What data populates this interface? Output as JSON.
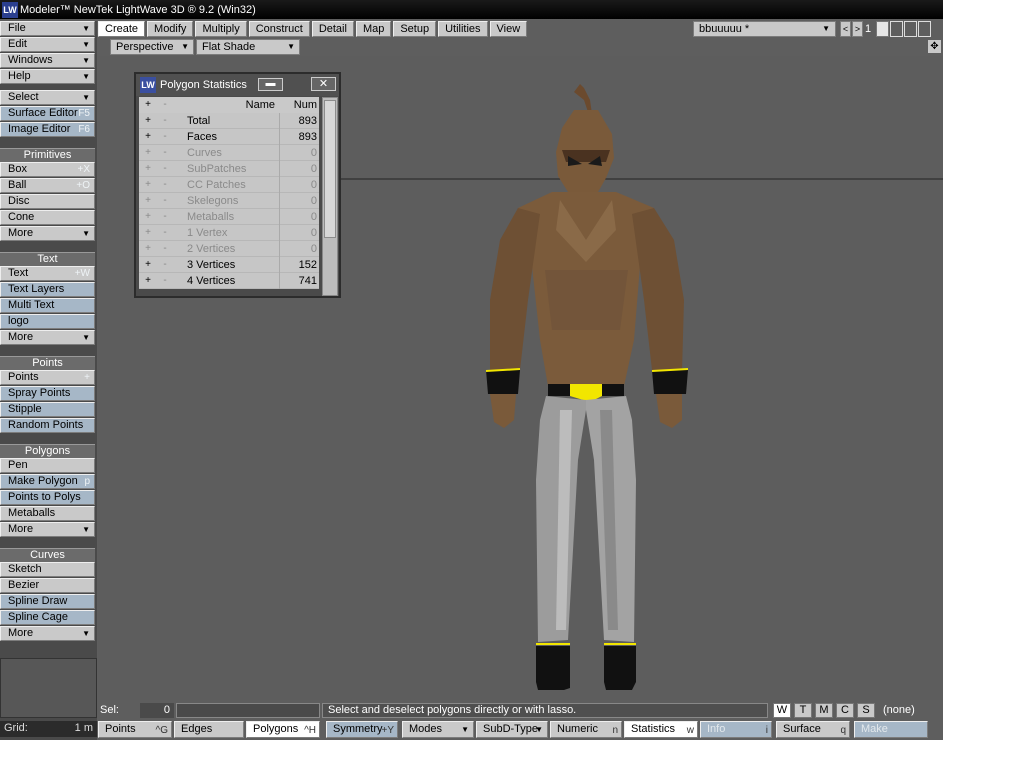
{
  "window": {
    "title": "Modeler™ NewTek LightWave 3D ® 9.2 (Win32)",
    "icon": "lightwave-logo-icon"
  },
  "sidebar": {
    "menus": [
      {
        "label": "File"
      },
      {
        "label": "Edit"
      },
      {
        "label": "Windows"
      },
      {
        "label": "Help"
      }
    ],
    "select_label": "Select",
    "surface_editor": {
      "label": "Surface Editor",
      "shortcut": "F5"
    },
    "image_editor": {
      "label": "Image Editor",
      "shortcut": "F6"
    },
    "primitives": {
      "header": "Primitives",
      "items": [
        {
          "label": "Box",
          "shortcut": "+X"
        },
        {
          "label": "Ball",
          "shortcut": "+O"
        },
        {
          "label": "Disc",
          "shortcut": ""
        },
        {
          "label": "Cone",
          "shortcut": ""
        },
        {
          "label": "More",
          "shortcut": ""
        }
      ]
    },
    "text": {
      "header": "Text",
      "items": [
        {
          "label": "Text",
          "shortcut": "+W"
        },
        {
          "label": "Text Layers",
          "shortcut": ""
        },
        {
          "label": "Multi Text",
          "shortcut": ""
        },
        {
          "label": "logo",
          "shortcut": ""
        },
        {
          "label": "More",
          "shortcut": ""
        }
      ]
    },
    "points": {
      "header": "Points",
      "items": [
        {
          "label": "Points",
          "shortcut": "+"
        },
        {
          "label": "Spray Points",
          "shortcut": ""
        },
        {
          "label": "Stipple",
          "shortcut": ""
        },
        {
          "label": "Random Points",
          "shortcut": ""
        }
      ]
    },
    "polygons": {
      "header": "Polygons",
      "items": [
        {
          "label": "Pen",
          "shortcut": ""
        },
        {
          "label": "Make Polygon",
          "shortcut": "p"
        },
        {
          "label": "Points to Polys",
          "shortcut": ""
        },
        {
          "label": "Metaballs",
          "shortcut": ""
        },
        {
          "label": "More",
          "shortcut": ""
        }
      ]
    },
    "curves": {
      "header": "Curves",
      "items": [
        {
          "label": "Sketch",
          "shortcut": ""
        },
        {
          "label": "Bezier",
          "shortcut": ""
        },
        {
          "label": "Spline Draw",
          "shortcut": ""
        },
        {
          "label": "Spline Cage",
          "shortcut": ""
        },
        {
          "label": "More",
          "shortcut": ""
        }
      ]
    },
    "grid": {
      "label": "Grid:",
      "value": "1 m"
    }
  },
  "tabs": [
    "Create",
    "Modify",
    "Multiply",
    "Construct",
    "Detail",
    "Map",
    "Setup",
    "Utilities",
    "View"
  ],
  "active_tab": "Create",
  "layer": {
    "name": "bbuuuuu *",
    "prev": "<",
    "next": ">",
    "number": "1"
  },
  "viewport": {
    "view": "Perspective",
    "shading": "Flat Shade",
    "move_glyph": "✥"
  },
  "stats_panel": {
    "title": "Polygon Statistics",
    "minimize": "▬",
    "close": "✕",
    "header": {
      "plus": "+",
      "minus": "-",
      "name": "Name",
      "num": "Num"
    },
    "rows": [
      {
        "name": "Total",
        "num": "893",
        "active": true
      },
      {
        "name": "Faces",
        "num": "893",
        "active": true
      },
      {
        "name": "Curves",
        "num": "0",
        "active": false
      },
      {
        "name": "SubPatches",
        "num": "0",
        "active": false
      },
      {
        "name": "CC Patches",
        "num": "0",
        "active": false
      },
      {
        "name": "Skelegons",
        "num": "0",
        "active": false
      },
      {
        "name": "Metaballs",
        "num": "0",
        "active": false
      },
      {
        "name": "1 Vertex",
        "num": "0",
        "active": false
      },
      {
        "name": "2 Vertices",
        "num": "0",
        "active": false
      },
      {
        "name": "3 Vertices",
        "num": "152",
        "active": true
      },
      {
        "name": "4 Vertices",
        "num": "741",
        "active": true
      }
    ]
  },
  "status": {
    "sel_label": "Sel:",
    "sel_value": "0",
    "hint": "Select and deselect polygons directly or with lasso.",
    "wtmcs": [
      "W",
      "T",
      "M",
      "C",
      "S"
    ],
    "surface_none": "(none)"
  },
  "bottom_toolbar": {
    "points": {
      "label": "Points",
      "shortcut": "^G"
    },
    "edges": {
      "label": "Edges",
      "shortcut": ""
    },
    "polygons": {
      "label": "Polygons",
      "shortcut": "^H"
    },
    "symmetry": {
      "label": "Symmetry",
      "shortcut": "+Y"
    },
    "modes": "Modes",
    "subd_type": "SubD-Type",
    "numeric": {
      "label": "Numeric",
      "shortcut": "n"
    },
    "statistics": {
      "label": "Statistics",
      "shortcut": "w"
    },
    "info": {
      "label": "Info",
      "shortcut": "i"
    },
    "surface": {
      "label": "Surface",
      "shortcut": "q"
    },
    "make": "Make"
  },
  "colors": {
    "button": "#c9c9c9",
    "button_alt": "#a6b7c7",
    "viewport": "#5d5d5d",
    "skin": "#7a5a3a",
    "pants": "#9c9c9c",
    "belt_buckle": "#f2e600"
  }
}
